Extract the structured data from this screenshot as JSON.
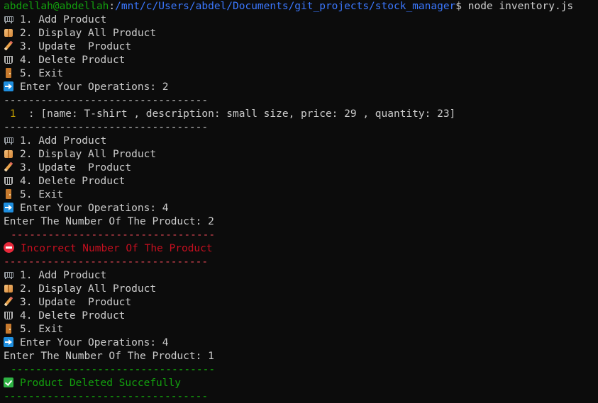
{
  "prompt": {
    "user_host": "abdellah@abdellah",
    "separator": ":",
    "path": "/mnt/c/Users/abdel/Documents/git_projects/stock_manager",
    "symbol": "$",
    "command": " node inventory.js"
  },
  "menu": {
    "add": "1. Add Product",
    "display": "2. Display All Product",
    "update": "3. Update  Product",
    "delete": "4. Delete Product",
    "exit": "5. Exit",
    "prompt_label": "Enter Your Operations: "
  },
  "session": {
    "op1": "2",
    "op2": "4",
    "op3": "4",
    "divider": "---------------------------------",
    "divider_long": "---------------------------------",
    "product_index": " 1",
    "product_line": "  : [name: T-shirt , description: small size, price: 29 , quantity: 23]",
    "number_prompt": "Enter The Number Of The Product: ",
    "num1": "2",
    "num2": "1",
    "error_msg": "Incorrect Number Of The Product",
    "success_msg": "Product Deleted Succefully"
  },
  "icons": {
    "add": "shopping-cart-icon",
    "display": "package-icon",
    "update": "pencil-icon",
    "delete": "wastebasket-icon",
    "exit": "door-icon",
    "prompt": "right-arrow-icon",
    "error": "no-entry-icon",
    "success": "check-mark-icon"
  },
  "colors": {
    "background": "#0c0c0c",
    "text": "#cccccc",
    "user_host": "#13a10e",
    "path": "#3b78ff",
    "error": "#e74856",
    "success": "#16c60c"
  }
}
